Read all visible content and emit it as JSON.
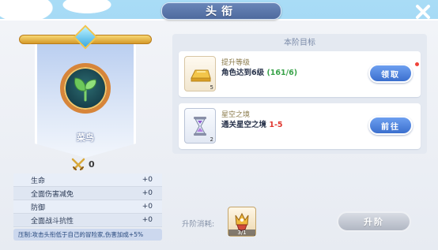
{
  "window": {
    "title": "头衔"
  },
  "title_card": {
    "name": "菜鸟",
    "battle_value": "0",
    "medal_icon": "sprout-medal-icon"
  },
  "stats": [
    {
      "name": "生命",
      "value": "+0"
    },
    {
      "name": "全面伤害减免",
      "value": "+0"
    },
    {
      "name": "防御",
      "value": "+0"
    },
    {
      "name": "全面战斗抗性",
      "value": "+0"
    }
  ],
  "bonus_text": "压制:攻击头衔低于自己的冒险家,伤害加成+5%",
  "goal_panel": {
    "header": "本阶目标",
    "tasks": [
      {
        "name": "提升等级",
        "desc": "角色达到6级",
        "progress": "(161/6)",
        "icon": "gold-bar-icon",
        "icon_count": "5",
        "button": "领取",
        "has_red_dot": true
      },
      {
        "name": "星空之境",
        "desc": "通关星空之境",
        "progress": "1-5",
        "icon": "hourglass-icon",
        "icon_count": "2",
        "button": "前往",
        "has_red_dot": false
      }
    ]
  },
  "upgrade": {
    "cost_label": "升阶消耗:",
    "cost_count": "3/1",
    "cost_icon": "crown-badge-icon",
    "button": "升阶"
  },
  "colors": {
    "accent_blue": "#3b6fce",
    "progress_green": "#3aa34a",
    "progress_red": "#e0372f",
    "title_bar": "#4e6a9e",
    "disabled_button": "#b1b7c3"
  }
}
